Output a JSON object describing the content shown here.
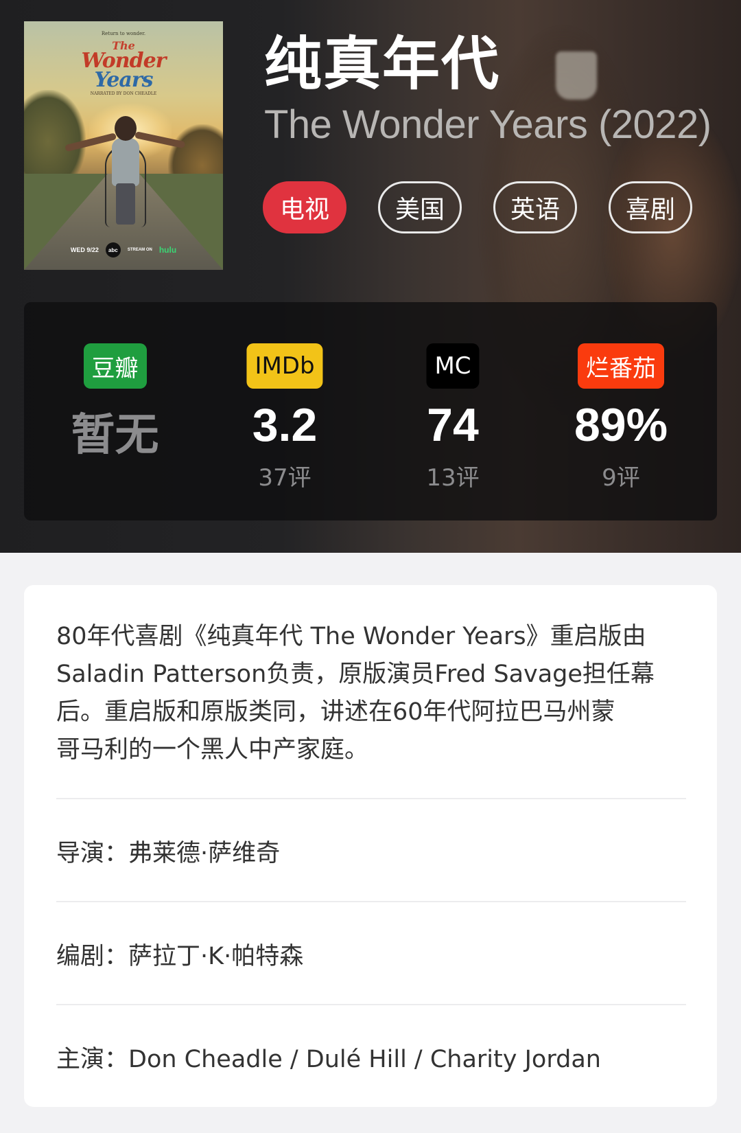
{
  "show": {
    "title_cn": "纯真年代",
    "title_en": "The Wonder Years (2022)"
  },
  "poster": {
    "tagline": "Return to wonder.",
    "logo_the": "The",
    "logo_wonder": "Wonder",
    "logo_years": "Years",
    "narrated_by": "NARRATED BY DON CHEADLE",
    "airdate": "WED 9/22",
    "network": "abc",
    "stream_on": "STREAM ON",
    "stream_service": "hulu"
  },
  "tags": [
    {
      "label": "电视",
      "primary": true
    },
    {
      "label": "美国",
      "primary": false
    },
    {
      "label": "英语",
      "primary": false
    },
    {
      "label": "喜剧",
      "primary": false
    }
  ],
  "ratings": [
    {
      "source": "豆瓣",
      "color": "#1f9e3f",
      "text_color": "#ffffff",
      "score": "暂无",
      "count": ""
    },
    {
      "source": "IMDb",
      "color": "#f2c318",
      "text_color": "#111111",
      "score": "3.2",
      "count": "37评"
    },
    {
      "source": "MC",
      "color": "#000000",
      "text_color": "#ffffff",
      "score": "74",
      "count": "13评"
    },
    {
      "source": "烂番茄",
      "color": "#fa3b0e",
      "text_color": "#ffffff",
      "score": "89%",
      "count": "9评"
    }
  ],
  "synopsis_lines": [
    "80年代喜剧《纯真年代 The Wonder Years》重启版由",
    "Saladin Patterson负责，原版演员Fred Savage担任幕",
    "后。重启版和原版类同，讲述在60年代阿拉巴马州蒙",
    "哥马利的一个黑人中产家庭。"
  ],
  "credits": {
    "director": "导演：弗莱德·萨维奇",
    "writer": "编剧：萨拉丁·K·帕特森",
    "cast": "主演：Don Cheadle / Dulé Hill / Charity Jordan"
  }
}
